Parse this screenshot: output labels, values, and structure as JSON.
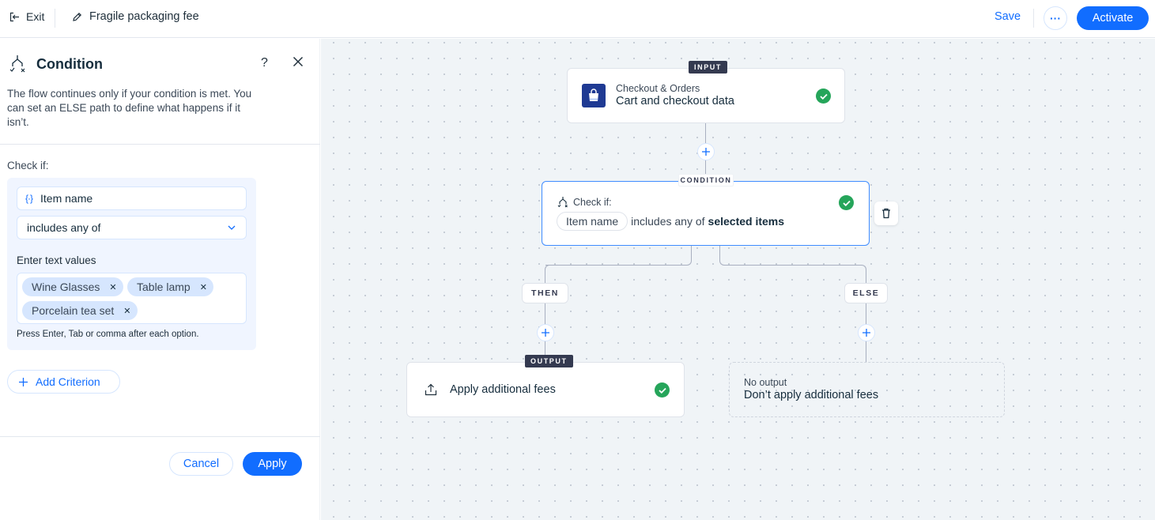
{
  "topbar": {
    "exit_label": "Exit",
    "automation_title": "Fragile packaging fee",
    "save_label": "Save",
    "more_label": "···",
    "activate_label": "Activate"
  },
  "panel": {
    "title": "Condition",
    "help_label": "?",
    "description": "The flow continues only if your condition is met. You can set an ELSE path to define what happens if it isn’t.",
    "check_if_label": "Check if:",
    "variable_field": "Item name",
    "operator_select": "includes any of",
    "values_label": "Enter text values",
    "values": [
      "Wine Glasses",
      "Table lamp",
      "Porcelain tea set"
    ],
    "values_hint": "Press Enter, Tab or comma after each option.",
    "add_criterion_label": "Add Criterion",
    "cancel_label": "Cancel",
    "apply_label": "Apply"
  },
  "canvas": {
    "input_node": {
      "badge": "INPUT",
      "app_name": "Checkout & Orders",
      "trigger_name": "Cart and checkout data",
      "status": "complete"
    },
    "condition_node": {
      "badge": "CONDITION",
      "check_if_label": "Check if:",
      "variable": "Item name",
      "operator": "includes any of",
      "value": "selected items",
      "status": "complete"
    },
    "then_label": "THEN",
    "else_label": "ELSE",
    "output_node": {
      "badge": "OUTPUT",
      "action_name": "Apply additional fees",
      "status": "complete"
    },
    "else_node": {
      "subtitle": "No output",
      "title": "Don’t apply additional fees"
    }
  },
  "colors": {
    "accent": "#116dff",
    "success": "#25a55a",
    "badge_dark": "#343a50",
    "app_icon_bg": "#1f3a93"
  }
}
